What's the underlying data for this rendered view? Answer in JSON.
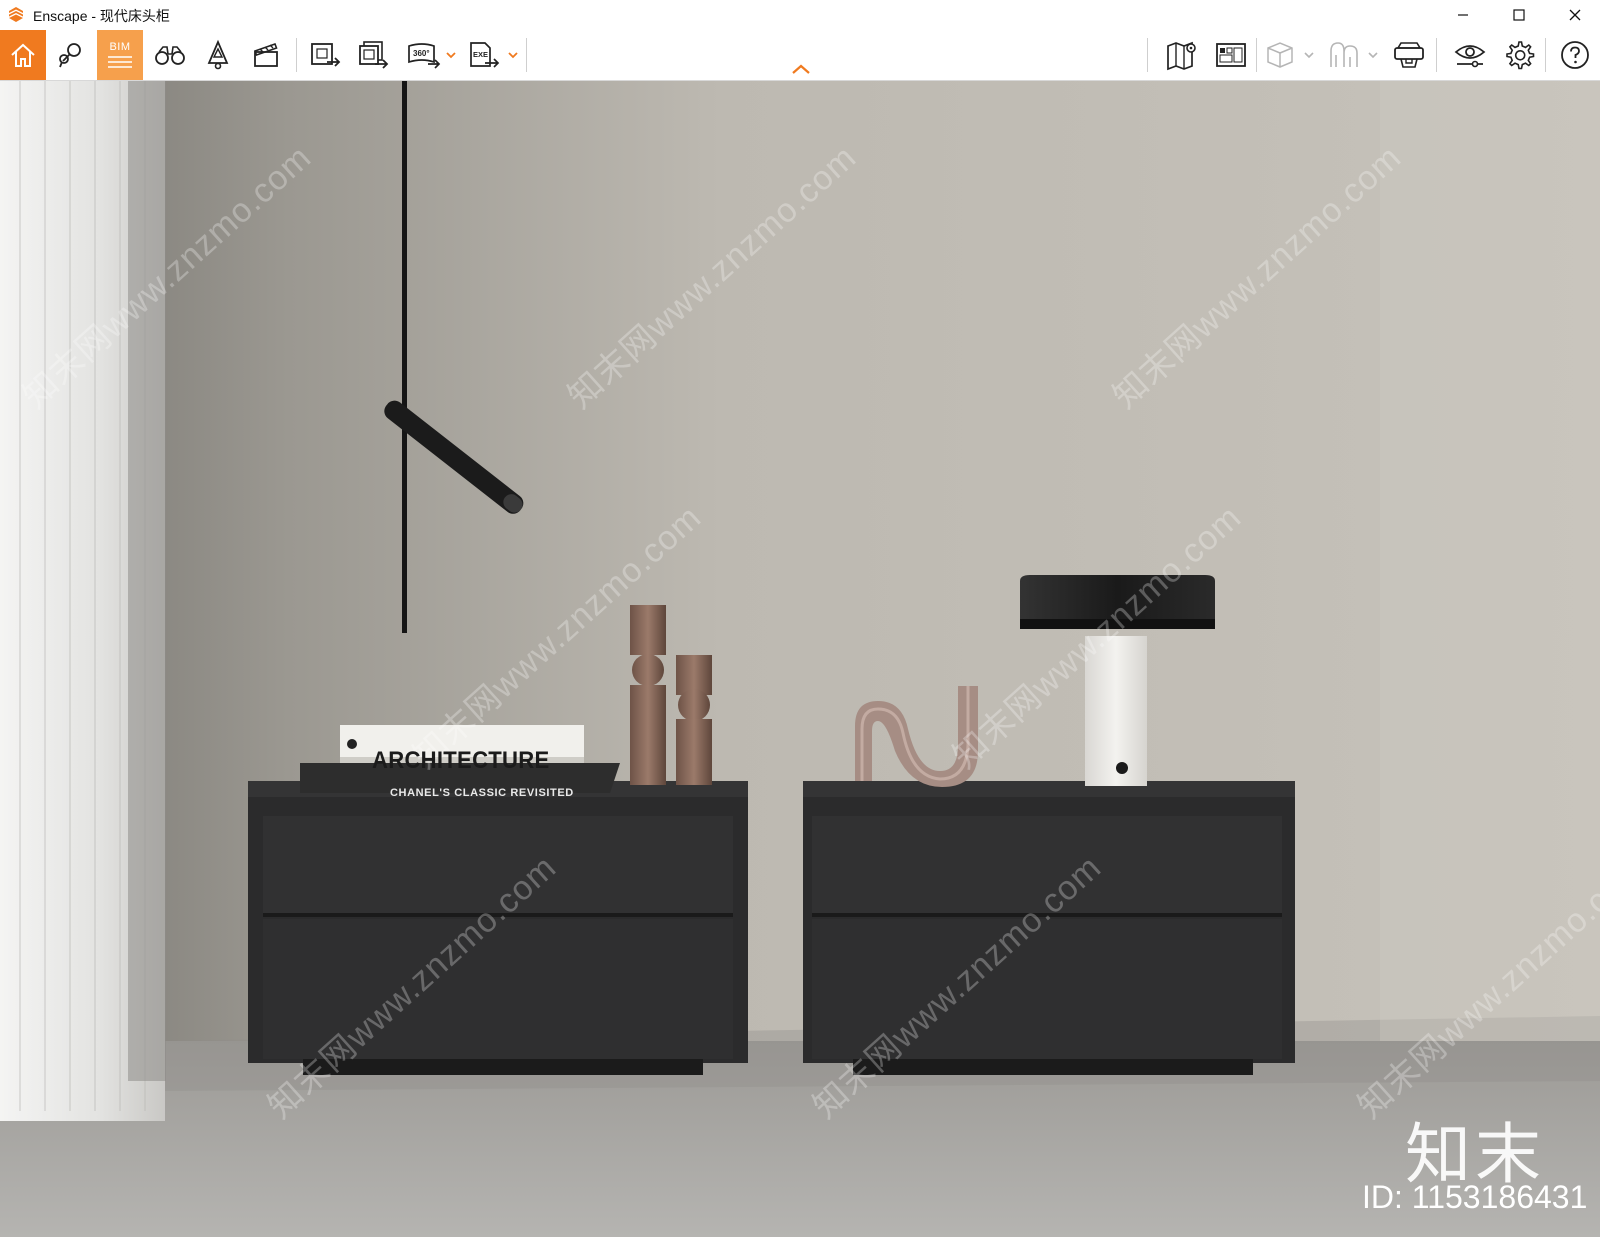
{
  "window": {
    "title": "Enscape - 现代床头柜",
    "controls": [
      "minimize",
      "maximize",
      "close"
    ]
  },
  "toolbar": {
    "left": [
      {
        "name": "home-icon",
        "active": true
      },
      {
        "name": "location-pins-icon"
      },
      {
        "name": "bim-icon",
        "label": "BIM",
        "highlight": true
      },
      {
        "name": "binoculars-icon"
      },
      {
        "name": "bell-icon"
      },
      {
        "name": "clapperboard-icon"
      },
      {
        "name": "export-image-icon"
      },
      {
        "name": "batch-render-icon"
      },
      {
        "name": "panorama-360-icon",
        "label": "360°",
        "dropdown": true
      },
      {
        "name": "exe-export-icon",
        "label": "EXE",
        "dropdown": true
      }
    ],
    "right": [
      {
        "name": "map-pin-icon"
      },
      {
        "name": "views-icon"
      },
      {
        "name": "cube-icon",
        "dropdown": true
      },
      {
        "name": "asset-library-icon",
        "dropdown": true
      },
      {
        "name": "vr-headset-icon"
      },
      {
        "name": "visual-settings-icon"
      },
      {
        "name": "gear-icon"
      },
      {
        "name": "help-icon"
      }
    ],
    "accent_color": "#f07a1f",
    "bim_color": "#f6a04c"
  },
  "viewport": {
    "watermark_text": "知末网www.znzmo.com",
    "logo_text": "知末",
    "id_text": "ID: 1153186431",
    "book_title": "ARCHITECTURE",
    "book_subtitle": "CHANEL'S CLASSIC REVISITED"
  }
}
